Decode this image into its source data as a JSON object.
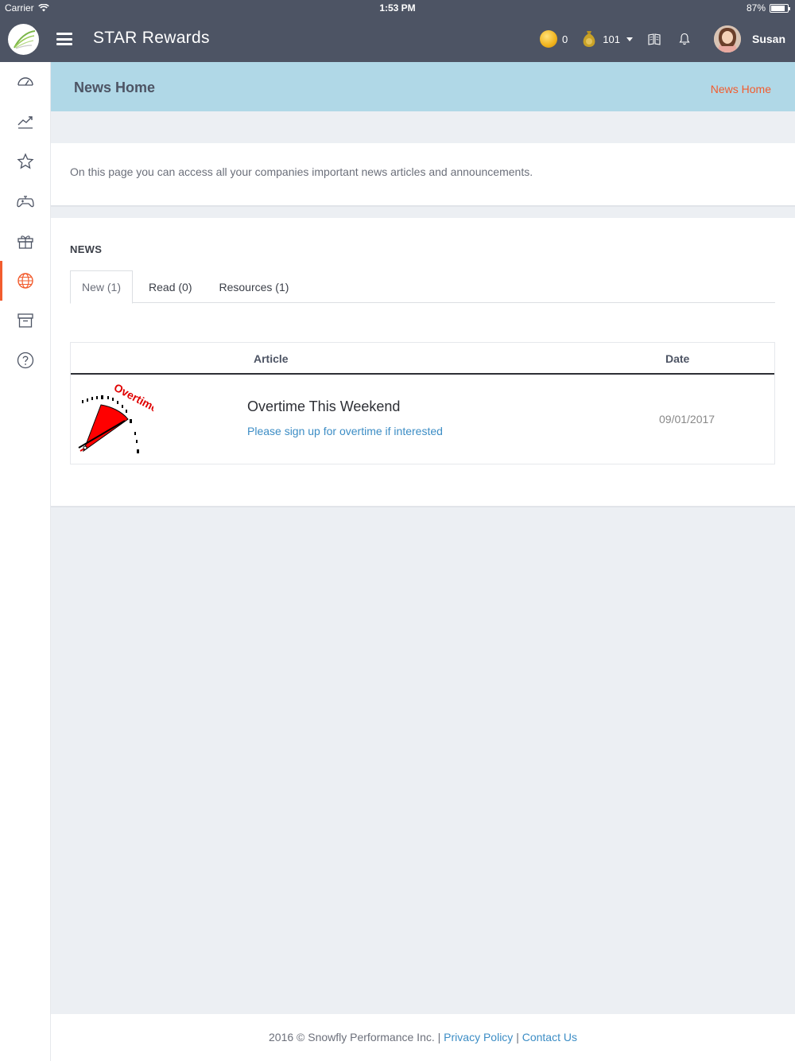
{
  "status_bar": {
    "carrier": "Carrier",
    "time": "1:53 PM",
    "battery": "87%"
  },
  "navbar": {
    "brand": "STAR Rewards",
    "coins": "0",
    "bag_points": "101",
    "username": "Susan"
  },
  "sidebar": {
    "items": [
      {
        "name": "dashboard",
        "icon": "speedometer-icon"
      },
      {
        "name": "performance",
        "icon": "trend-chart-icon"
      },
      {
        "name": "recognition",
        "icon": "star-icon"
      },
      {
        "name": "games",
        "icon": "gamepad-icon"
      },
      {
        "name": "rewards",
        "icon": "gift-icon"
      },
      {
        "name": "news",
        "icon": "globe-icon",
        "active": true
      },
      {
        "name": "archive",
        "icon": "archive-box-icon"
      },
      {
        "name": "help",
        "icon": "help-circle-icon"
      }
    ]
  },
  "page_header": {
    "title": "News Home",
    "breadcrumb": "News Home"
  },
  "intro": {
    "text": "On this page you can access all your companies important news articles and announcements."
  },
  "news": {
    "label": "NEWS",
    "tabs": [
      {
        "label": "New (1)",
        "active": true
      },
      {
        "label": "Read (0)"
      },
      {
        "label": "Resources (1)"
      }
    ],
    "table": {
      "headers": {
        "article": "Article",
        "date": "Date"
      },
      "rows": [
        {
          "thumbnail_text": "Overtime",
          "title": "Overtime This Weekend",
          "subtitle": "Please sign up for overtime if interested",
          "date": "09/01/2017"
        }
      ]
    }
  },
  "footer": {
    "copyright": "2016 © Snowfly Performance Inc. |",
    "separator": "|",
    "privacy": "Privacy Policy",
    "contact": "Contact Us"
  },
  "colors": {
    "navbar": "#4d5464",
    "header": "#b0d8e7",
    "accent": "#f25c2e",
    "link": "#3c8dc5"
  }
}
